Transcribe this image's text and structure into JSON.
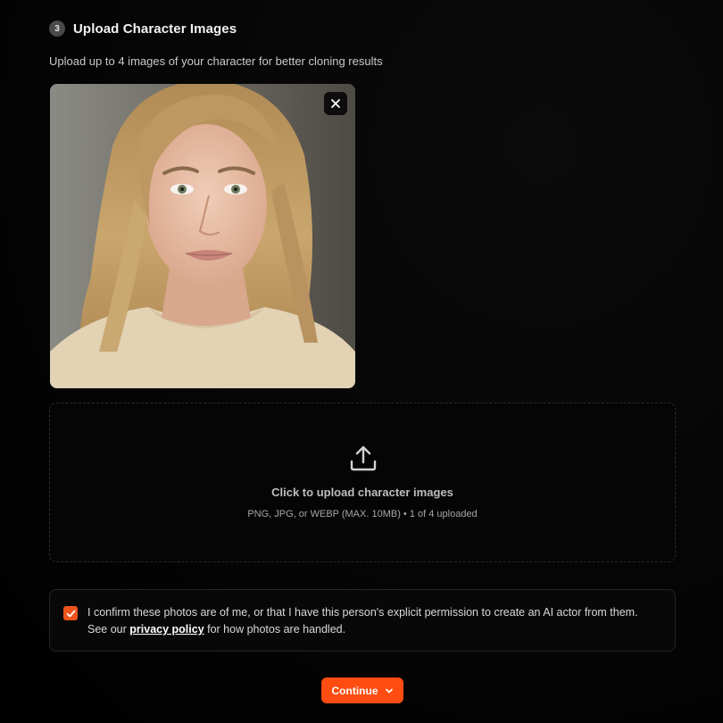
{
  "section": {
    "step_number": "3",
    "title": "Upload Character Images",
    "subtitle": "Upload up to 4 images of your character for better cloning results"
  },
  "uploaded_images": [
    {
      "remove_icon": "close-icon"
    }
  ],
  "dropzone": {
    "icon": "upload-icon",
    "title": "Click to upload character images",
    "hint": "PNG, JPG, or WEBP (MAX. 10MB) • 1 of 4 uploaded"
  },
  "consent": {
    "checked": true,
    "text_before": "I confirm these photos are of me, or that I have this person's explicit permission to create an AI actor from them. See our ",
    "link_text": "privacy policy",
    "text_after": " for how photos are handled."
  },
  "continue_button": {
    "label": "Continue",
    "icon": "chevron-down-icon"
  },
  "colors": {
    "accent": "#ff4d12",
    "checkbox": "#f0531c",
    "background": "#000000"
  }
}
